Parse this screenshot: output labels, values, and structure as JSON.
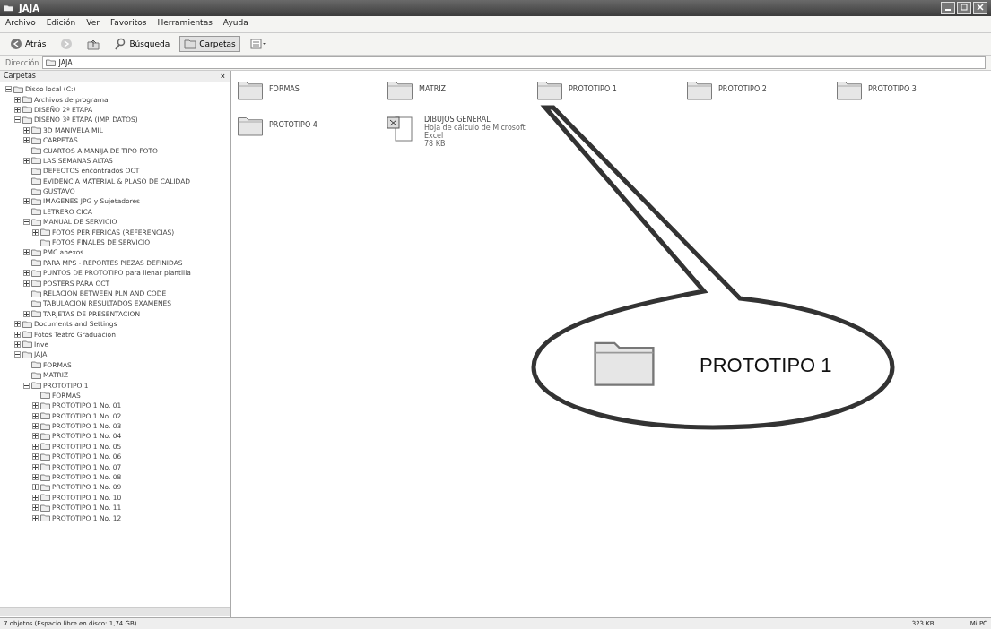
{
  "window": {
    "title": "JAJA"
  },
  "menu": [
    "Archivo",
    "Edición",
    "Ver",
    "Favoritos",
    "Herramientas",
    "Ayuda"
  ],
  "toolbar": [
    {
      "kind": "back",
      "label": "Atrás"
    },
    {
      "kind": "forward"
    },
    {
      "kind": "up"
    },
    {
      "kind": "search",
      "label": "Búsqueda"
    },
    {
      "kind": "folders",
      "label": "Carpetas",
      "selected": true
    },
    {
      "kind": "views"
    }
  ],
  "address": {
    "label": "Dirección",
    "value": "JAJA"
  },
  "sidebar": {
    "title": "Carpetas",
    "close": "×",
    "tree": [
      {
        "label": "Disco local (C:)",
        "expanded": true,
        "children": [
          {
            "label": "Archivos de programa",
            "expanded": false
          },
          {
            "label": "DISEÑO 2ª ETAPA",
            "expanded": false
          },
          {
            "label": "DISEÑO 3ª ETAPA (IMP. DATOS)",
            "expanded": true,
            "children": [
              {
                "label": "3D MANIVELA MIL",
                "expanded": false
              },
              {
                "label": "CARPETAS",
                "expanded": false
              },
              {
                "label": "CUARTOS A MANIJA DE TIPO FOTO"
              },
              {
                "label": "LAS SEMANAS ALTAS",
                "expanded": false
              },
              {
                "label": "DEFECTOS encontrados OCT"
              },
              {
                "label": "EVIDENCIA MATERIAL & PLASO DE CALIDAD"
              },
              {
                "label": "GUSTAVO"
              },
              {
                "label": "IMAGENES JPG y Sujetadores",
                "expanded": false
              },
              {
                "label": "LETRERO CICA"
              },
              {
                "label": "MANUAL DE SERVICIO",
                "expanded": true,
                "children": [
                  {
                    "label": "FOTOS PERIFERICAS (REFERENCIAS)",
                    "expanded": false
                  },
                  {
                    "label": "FOTOS FINALES DE SERVICIO"
                  }
                ]
              },
              {
                "label": "PMC anexos",
                "expanded": false
              },
              {
                "label": "PARA MPS - REPORTES PIEZAS DEFINIDAS"
              },
              {
                "label": "PUNTOS DE PROTOTIPO para llenar plantilla",
                "expanded": false
              },
              {
                "label": "POSTERS PARA OCT",
                "expanded": false
              },
              {
                "label": "RELACION BETWEEN PLN AND CODE"
              },
              {
                "label": "TABULACION RESULTADOS EXAMENES"
              },
              {
                "label": "TARJETAS DE PRESENTACION",
                "expanded": false
              }
            ]
          },
          {
            "label": "Documents and Settings",
            "expanded": false
          },
          {
            "label": "Fotos Teatro Graduacion",
            "expanded": false
          },
          {
            "label": "Inve",
            "expanded": false
          },
          {
            "label": "JAJA",
            "expanded": true,
            "children": [
              {
                "label": "FORMAS"
              },
              {
                "label": "MATRIZ"
              },
              {
                "label": "PROTOTIPO 1",
                "expanded": true,
                "children": [
                  {
                    "label": "FORMAS"
                  },
                  {
                    "label": "PROTOTIPO 1 No. 01",
                    "expanded": false
                  },
                  {
                    "label": "PROTOTIPO 1 No. 02",
                    "expanded": false
                  },
                  {
                    "label": "PROTOTIPO 1 No. 03",
                    "expanded": false
                  },
                  {
                    "label": "PROTOTIPO 1 No. 04",
                    "expanded": false
                  },
                  {
                    "label": "PROTOTIPO 1 No. 05",
                    "expanded": false
                  },
                  {
                    "label": "PROTOTIPO 1 No. 06",
                    "expanded": false
                  },
                  {
                    "label": "PROTOTIPO 1 No. 07",
                    "expanded": false
                  },
                  {
                    "label": "PROTOTIPO 1 No. 08",
                    "expanded": false
                  },
                  {
                    "label": "PROTOTIPO 1 No. 09",
                    "expanded": false
                  },
                  {
                    "label": "PROTOTIPO 1 No. 10",
                    "expanded": false
                  },
                  {
                    "label": "PROTOTIPO 1 No. 11",
                    "expanded": false
                  },
                  {
                    "label": "PROTOTIPO 1 No. 12",
                    "expanded": false
                  }
                ]
              }
            ]
          }
        ]
      }
    ]
  },
  "files": [
    {
      "kind": "folder",
      "name": "FORMAS"
    },
    {
      "kind": "folder",
      "name": "MATRIZ"
    },
    {
      "kind": "folder",
      "name": "PROTOTIPO 1"
    },
    {
      "kind": "folder",
      "name": "PROTOTIPO 2"
    },
    {
      "kind": "folder",
      "name": "PROTOTIPO 3"
    },
    {
      "kind": "folder",
      "name": "PROTOTIPO 4"
    },
    {
      "kind": "document",
      "name": "DIBUJOS GENERAL",
      "detail": "Hoja de cálculo de Microsoft Excel",
      "size": "78 KB"
    }
  ],
  "callout": {
    "label": "PROTOTIPO 1"
  },
  "status_bar": {
    "text": "7 objetos (Espacio libre en disco: 1,74 GB)",
    "size": "323 KB",
    "zone": "Mi PC"
  }
}
